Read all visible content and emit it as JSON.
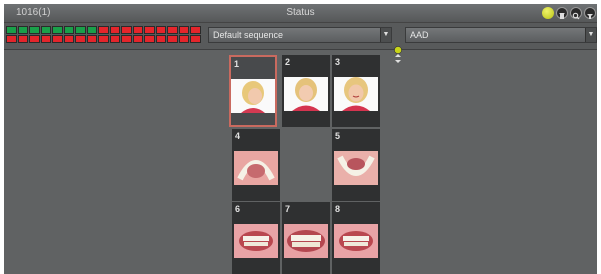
{
  "window": {
    "id_label": "1016(1)",
    "title": "Status"
  },
  "status_indicators": {
    "row1": [
      "g",
      "g",
      "g",
      "g",
      "g",
      "g",
      "g",
      "g",
      "r",
      "r",
      "r",
      "r",
      "r",
      "r",
      "r",
      "r",
      "r"
    ],
    "row2": [
      "r",
      "r",
      "r",
      "r",
      "r",
      "r",
      "r",
      "r",
      "r",
      "r",
      "r",
      "r",
      "r",
      "r",
      "r",
      "r",
      "r"
    ]
  },
  "toolbar": {
    "sequence_select": {
      "value": "Default sequence"
    },
    "filter_select": {
      "value": "AAD"
    }
  },
  "thumbnails": [
    {
      "number": "1",
      "kind": "face-profile"
    },
    {
      "number": "2",
      "kind": "face-front"
    },
    {
      "number": "3",
      "kind": "face-smile"
    },
    {
      "number": "4",
      "kind": "upper-arch"
    },
    {
      "number": "5",
      "kind": "lower-arch"
    },
    {
      "number": "6",
      "kind": "teeth-right"
    },
    {
      "number": "7",
      "kind": "teeth-front"
    },
    {
      "number": "8",
      "kind": "teeth-left"
    }
  ],
  "colors": {
    "ok": "#1aa04a",
    "missing": "#e4252b",
    "selected_border": "#c96a5f",
    "status_light": "#c8d41a"
  }
}
